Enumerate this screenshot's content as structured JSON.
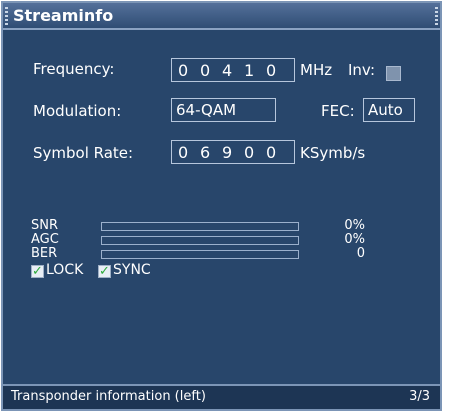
{
  "window": {
    "title": "Streaminfo"
  },
  "frequency": {
    "label": "Frequency:",
    "digits": [
      "0",
      "0",
      "4",
      "1",
      "0"
    ],
    "unit": "MHz",
    "inv_label": "Inv:"
  },
  "modulation": {
    "label": "Modulation:",
    "value": "64-QAM",
    "fec_label": "FEC:",
    "fec_value": "Auto"
  },
  "symbol_rate": {
    "label": "Symbol Rate:",
    "digits": [
      "0",
      "6",
      "9",
      "0",
      "0"
    ],
    "unit": "KSymb/s"
  },
  "meters": [
    {
      "label": "SNR",
      "value": "0%",
      "level": 0
    },
    {
      "label": "AGC",
      "value": "0%",
      "level": 0
    },
    {
      "label": "BER",
      "value": "0",
      "level": 0
    }
  ],
  "status": [
    {
      "label": "LOCK",
      "checked": true
    },
    {
      "label": "SYNC",
      "checked": true
    }
  ],
  "footer": {
    "text": "Transponder information (left)",
    "page": "3/3"
  }
}
